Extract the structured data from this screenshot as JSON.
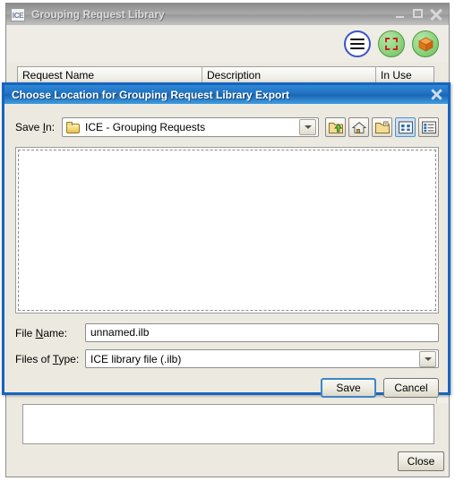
{
  "background_window": {
    "app_logo_text": "ICE",
    "title": "Grouping Request Library",
    "window_controls": [
      {
        "name": "minimize",
        "label": "—"
      },
      {
        "name": "maximize",
        "label": "□"
      },
      {
        "name": "close",
        "label": "✕"
      }
    ],
    "toolbar_buttons": [
      {
        "name": "menu-button",
        "icon": "hamburger-menu-icon",
        "color": "#3a54c8"
      },
      {
        "name": "select-region-button",
        "icon": "dashed-square-icon",
        "color": "#8ed47f"
      },
      {
        "name": "export-package-button",
        "icon": "orange-box-icon",
        "color": "#8ed47f"
      }
    ],
    "table": {
      "columns": [
        "Request Name",
        "Description",
        "In Use"
      ],
      "rows": []
    },
    "close_button_label": "Close"
  },
  "dialog": {
    "title": "Choose Location for Grouping Request Library Export",
    "close_icon": "close-icon",
    "save_in": {
      "label": "Save In:",
      "label_prefix": "Save ",
      "label_mnemonic": "I",
      "label_suffix": "n:",
      "value": "ICE - Grouping Requests",
      "folder_icon": "folder-icon"
    },
    "toolbar": [
      {
        "name": "up-one-level-button",
        "icon": "folder-up-arrow-icon"
      },
      {
        "name": "home-button",
        "icon": "home-icon"
      },
      {
        "name": "new-folder-button",
        "icon": "new-folder-icon"
      },
      {
        "name": "list-view-button",
        "icon": "list-view-icon",
        "selected": true
      },
      {
        "name": "details-view-button",
        "icon": "details-view-icon",
        "selected": false
      }
    ],
    "file_list": {
      "items": []
    },
    "file_name": {
      "label": "File Name:",
      "label_prefix": "File ",
      "label_mnemonic": "N",
      "label_suffix": "ame:",
      "value": "unnamed.ilb"
    },
    "files_of_type": {
      "label": "Files of Type:",
      "label_prefix": "Files of ",
      "label_mnemonic": "T",
      "label_suffix": "ype:",
      "value": "ICE library file (.ilb)",
      "options": [
        "ICE library file (.ilb)"
      ]
    },
    "buttons": {
      "save": "Save",
      "cancel": "Cancel"
    },
    "accent_color": "#1565c0"
  }
}
